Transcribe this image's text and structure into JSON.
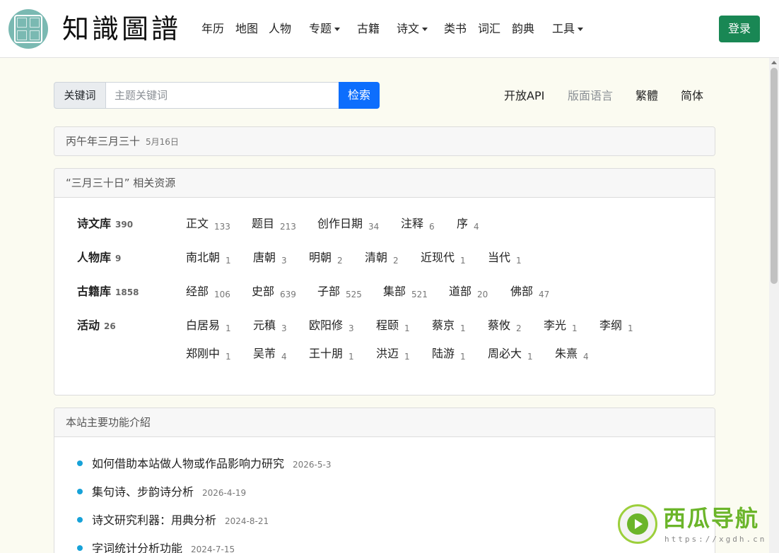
{
  "nav": {
    "brand": "知識圖譜",
    "items": [
      "年历",
      "地图",
      "人物",
      "专题",
      "古籍",
      "诗文",
      "类书",
      "词汇",
      "韵典",
      "工具"
    ],
    "login": "登录"
  },
  "search": {
    "label": "关键词",
    "placeholder": "主题关键词",
    "button": "检索"
  },
  "top_links": [
    "开放API",
    "版面语言",
    "繁體",
    "简体"
  ],
  "date_card": {
    "lunar": "丙午年三月三十",
    "solar": "5月16日"
  },
  "resources": {
    "header": "“三月三十日” 相关资源",
    "rows": [
      {
        "title": "诗文库",
        "count": "390",
        "items": [
          {
            "label": "正文",
            "count": "133"
          },
          {
            "label": "题目",
            "count": "213"
          },
          {
            "label": "创作日期",
            "count": "34"
          },
          {
            "label": "注释",
            "count": "6"
          },
          {
            "label": "序",
            "count": "4"
          }
        ]
      },
      {
        "title": "人物库",
        "count": "9",
        "items": [
          {
            "label": "南北朝",
            "count": "1"
          },
          {
            "label": "唐朝",
            "count": "3"
          },
          {
            "label": "明朝",
            "count": "2"
          },
          {
            "label": "清朝",
            "count": "2"
          },
          {
            "label": "近现代",
            "count": "1"
          },
          {
            "label": "当代",
            "count": "1"
          }
        ]
      },
      {
        "title": "古籍库",
        "count": "1858",
        "items": [
          {
            "label": "经部",
            "count": "106"
          },
          {
            "label": "史部",
            "count": "639"
          },
          {
            "label": "子部",
            "count": "525"
          },
          {
            "label": "集部",
            "count": "521"
          },
          {
            "label": "道部",
            "count": "20"
          },
          {
            "label": "佛部",
            "count": "47"
          }
        ]
      },
      {
        "title": "活动",
        "count": "26",
        "items": [
          {
            "label": "白居易",
            "count": "1"
          },
          {
            "label": "元稹",
            "count": "3"
          },
          {
            "label": "欧阳修",
            "count": "3"
          },
          {
            "label": "程颐",
            "count": "1"
          },
          {
            "label": "蔡京",
            "count": "1"
          },
          {
            "label": "蔡攸",
            "count": "2"
          },
          {
            "label": "李光",
            "count": "1"
          },
          {
            "label": "李纲",
            "count": "1"
          },
          {
            "label": "郑刚中",
            "count": "1"
          },
          {
            "label": "吴芾",
            "count": "4"
          },
          {
            "label": "王十朋",
            "count": "1"
          },
          {
            "label": "洪迈",
            "count": "1"
          },
          {
            "label": "陆游",
            "count": "1"
          },
          {
            "label": "周必大",
            "count": "1"
          },
          {
            "label": "朱熹",
            "count": "4"
          }
        ]
      }
    ]
  },
  "features": {
    "header": "本站主要功能介紹",
    "items": [
      {
        "title": "如何借助本站做人物或作品影响力研究",
        "date": "2026-5-3"
      },
      {
        "title": "集句诗、步韵诗分析",
        "date": "2026-4-19"
      },
      {
        "title": "诗文研究利器：用典分析",
        "date": "2024-8-21"
      },
      {
        "title": "字词统计分析功能",
        "date": "2024-7-15"
      }
    ]
  },
  "watermark": {
    "name": "西瓜导航",
    "url": "https://xgdh.cn"
  },
  "colors": {
    "login_green": "#198754",
    "search_blue": "#0d6efd",
    "bullet_cyan": "#17a2d8",
    "watermark_green": "#6bb52a"
  }
}
